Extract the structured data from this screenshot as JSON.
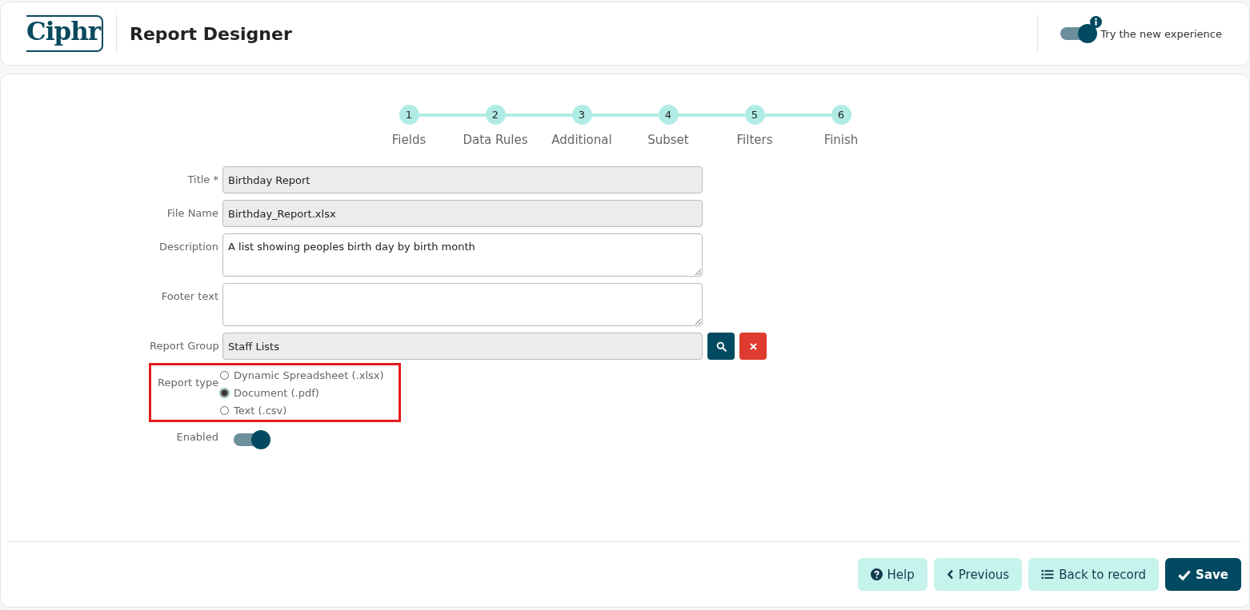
{
  "header": {
    "logo": "Ciphr",
    "title": "Report Designer",
    "experience_toggle": {
      "label": "Try the new experience",
      "on": true
    }
  },
  "steps": [
    {
      "number": "1",
      "label": "Fields"
    },
    {
      "number": "2",
      "label": "Data Rules"
    },
    {
      "number": "3",
      "label": "Additional"
    },
    {
      "number": "4",
      "label": "Subset"
    },
    {
      "number": "5",
      "label": "Filters"
    },
    {
      "number": "6",
      "label": "Finish"
    }
  ],
  "form": [
    {
      "kind": "text",
      "label": "Title *",
      "value": "Birthday Report"
    },
    {
      "kind": "text",
      "label": "File Name",
      "value": "Birthday_Report.xlsx"
    },
    {
      "kind": "textarea",
      "label": "Description",
      "value": "A list showing peoples birth day by birth month"
    },
    {
      "kind": "textarea",
      "label": "Footer text"
    },
    {
      "kind": "lookup",
      "label": "Report Group",
      "value": "Staff Lists"
    },
    {
      "kind": "radio",
      "label": "Report type",
      "highlighted": true,
      "options": [
        {
          "label": "Dynamic Spreadsheet (.xlsx)",
          "selected": false
        },
        {
          "label": "Document (.pdf)",
          "selected": true
        },
        {
          "label": "Text (.csv)",
          "selected": false
        }
      ]
    },
    {
      "kind": "toggle",
      "label": "Enabled",
      "on": true
    }
  ],
  "buttons": [
    {
      "kind": "help",
      "label": "Help"
    },
    {
      "kind": "previous",
      "label": "Previous"
    },
    {
      "kind": "back",
      "label": "Back to record"
    },
    {
      "kind": "save",
      "label": "Save"
    }
  ]
}
